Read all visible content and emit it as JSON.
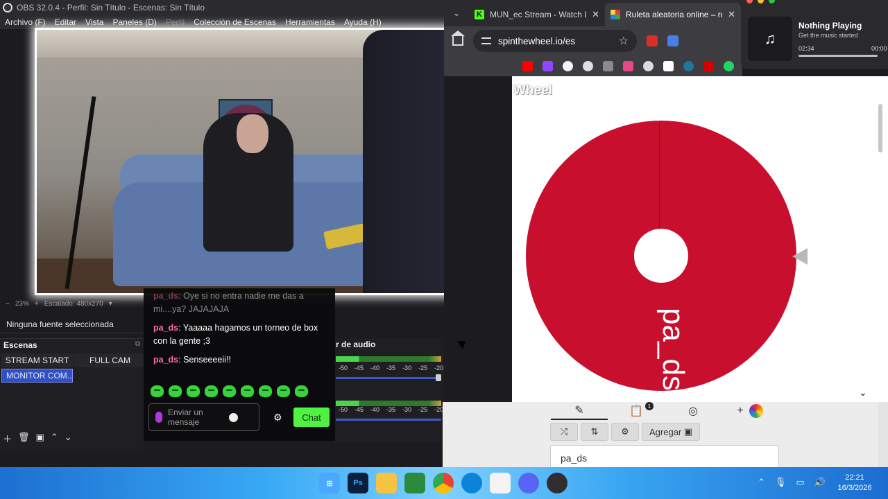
{
  "obs": {
    "title": "OBS 32.0.4 - Perfil: Sin Título - Escenas: Sin Título",
    "menu": [
      "Archivo (F)",
      "Editar",
      "Vista",
      "Paneles (D)",
      "Perfil",
      "Colección de Escenas",
      "Herramientas",
      "Ayuda (H)"
    ],
    "zoom": "23%",
    "scale_label": "Escalado: 480x270",
    "source_status": "Ninguna fuente seleccionada",
    "scenes_title": "Escenas",
    "scenes": [
      "STREAM START",
      "FULL CAM",
      "MONITOR COM..."
    ],
    "active_scene": "MONITOR COM...",
    "mixer_title": "r de audio",
    "meter_ticks": [
      "-50",
      "-45",
      "-40",
      "-35",
      "-30",
      "-25",
      "-20"
    ]
  },
  "chat": {
    "messages": [
      {
        "user": "pa_ds",
        "text": ": Oye si no entra nadie me das a mi....ya? JAJAJAJA",
        "faded": true
      },
      {
        "user": "pa_ds",
        "text": ": Yaaaaa hagamos un torneo de box con la gente ;3",
        "faded": false
      },
      {
        "user": "pa_ds",
        "text": ": Senseeeeii!!",
        "faded": false
      }
    ],
    "input_placeholder": "Enviar un mensaje",
    "send_label": "Chat",
    "emote_count": 9
  },
  "browser": {
    "tabs": [
      {
        "title": "MUN_ec Stream - Watch Live",
        "active": false
      },
      {
        "title": "Ruleta aleatoria online – ruleta",
        "active": true
      }
    ],
    "url": "spinthewheel.io/es"
  },
  "wheel": {
    "logo": "Wheel",
    "entry": "pa_ds",
    "color": "#c8102e",
    "add_label": "Agregar",
    "badge": "1",
    "entries_input": "pa_ds"
  },
  "notification": {
    "title": "Nothing Playing",
    "subtitle": "Get the music started",
    "time_left": "02:34",
    "time_right": "00:00",
    "progress": 1.0
  },
  "taskbar": {
    "time": "22:21",
    "date": "16/3/2026"
  }
}
